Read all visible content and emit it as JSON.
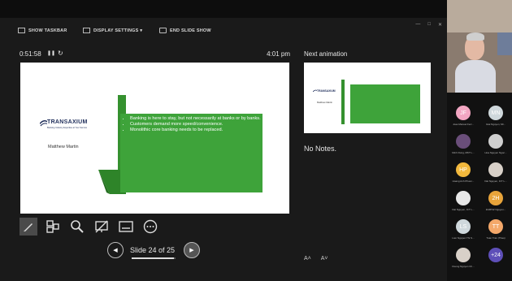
{
  "toolbar": {
    "show_taskbar": "SHOW TASKBAR",
    "display_settings": "DISPLAY SETTINGS ▾",
    "end_slide_show": "END SLIDE SHOW",
    "window_controls": [
      "—",
      "□",
      "✕"
    ]
  },
  "timer": {
    "elapsed": "0:51:58",
    "pause_icon": "❚❚",
    "reset_icon": "↻",
    "clock": "4:01 pm"
  },
  "current_slide": {
    "logo_text": "TRANSAXIUM",
    "logo_subtitle": "Banking Industry Expertise at Your Service",
    "presenter_name": "Matthew Martin",
    "bullets": [
      "Banking is here to stay, but not necessarily at banks or by banks.",
      "Customers demand more speed/convenience.",
      "Monolithic core banking needs to be replaced."
    ],
    "accent_color": "#3ea33a"
  },
  "next": {
    "label": "Next animation",
    "presenter_name": "Matthew Martin"
  },
  "notes": {
    "text": "No Notes."
  },
  "nav": {
    "slide_count": "Slide 24 of 25",
    "current": 24,
    "total": 25,
    "prev_icon": "◀",
    "next_icon": "▶"
  },
  "font_controls": {
    "increase": "A˄",
    "decrease": "A˅"
  },
  "participants": [
    {
      "initials": "JF",
      "name": "Joao Manuel Ferr...",
      "color": "#f2a6c2"
    },
    {
      "initials": "MN",
      "name": "Giai Nguyen, MI...",
      "color": "#cfd8dc"
    },
    {
      "initials": "",
      "name": "Minh Dung, MKT L...",
      "color": "#6a4e7a"
    },
    {
      "initials": "",
      "name": "Hoa Nguyen Ngoc...",
      "color": "#cfcfcf"
    },
    {
      "initials": "HP",
      "name": "Hoang Anh Phuoc...",
      "color": "#f2b83c"
    },
    {
      "initials": "",
      "name": "Dat Nguyen, ICT L...",
      "color": "#d8d0c8"
    },
    {
      "initials": "",
      "name": "Dat Nguyen, ICT L...",
      "color": "#e8e8e8"
    },
    {
      "initials": "2H",
      "name": "2H0P32 Nguyen...",
      "color": "#e8a43a"
    },
    {
      "initials": "LS",
      "name": "Lien Nguyen Thi S...",
      "color": "#cfd8dc"
    },
    {
      "initials": "TT",
      "name": "Tuan Tran (Thao)",
      "color": "#f4a86a"
    },
    {
      "initials": "",
      "name": "Duong Nguyen Ch...",
      "color": "#d8d0c8"
    },
    {
      "initials": "+24",
      "name": "",
      "color": "#5e4fb8"
    }
  ]
}
